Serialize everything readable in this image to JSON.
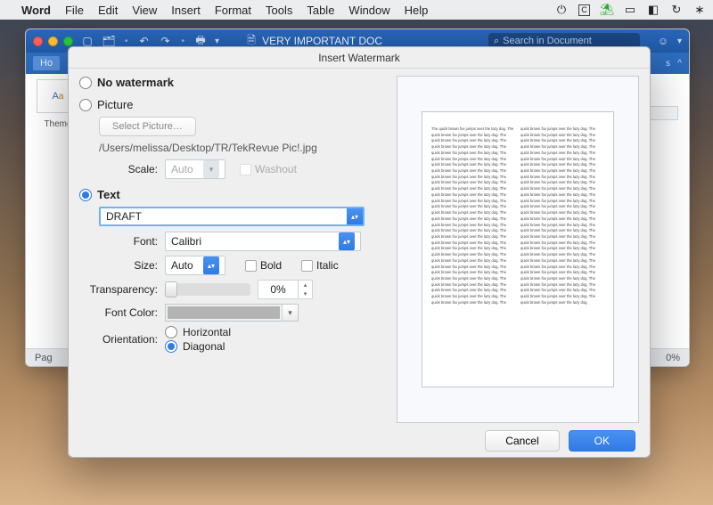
{
  "menubar": {
    "app": "Word",
    "items": [
      "File",
      "Edit",
      "View",
      "Insert",
      "Format",
      "Tools",
      "Table",
      "Window",
      "Help"
    ]
  },
  "toolbar": {
    "doc_title": "VERY IMPORTANT DOC",
    "search_placeholder": "Search in Document"
  },
  "tabs": {
    "home": "Ho"
  },
  "themes_label": "Theme",
  "statusbar": {
    "left": "Pag",
    "right": "0%"
  },
  "dialog": {
    "title": "Insert Watermark",
    "no_watermark": "No watermark",
    "picture_label": "Picture",
    "select_picture_btn": "Select Picture…",
    "picture_path": "/Users/melissa/Desktop/TR/TekRevue Pic!.jpg",
    "scale_label": "Scale:",
    "scale_value": "Auto",
    "washout_label": "Washout",
    "text_label": "Text",
    "text_value": "DRAFT",
    "font_label": "Font:",
    "font_value": "Calibri",
    "size_label": "Size:",
    "size_value": "Auto",
    "bold_label": "Bold",
    "italic_label": "Italic",
    "transparency_label": "Transparency:",
    "transparency_value": "0%",
    "font_color_label": "Font Color:",
    "orientation_label": "Orientation:",
    "orientation_h": "Horizontal",
    "orientation_d": "Diagonal",
    "cancel": "Cancel",
    "ok": "OK",
    "preview_text": "The quick brown fox jumps over the lazy dog."
  },
  "colors": {
    "accent": "#2f7ae5"
  }
}
